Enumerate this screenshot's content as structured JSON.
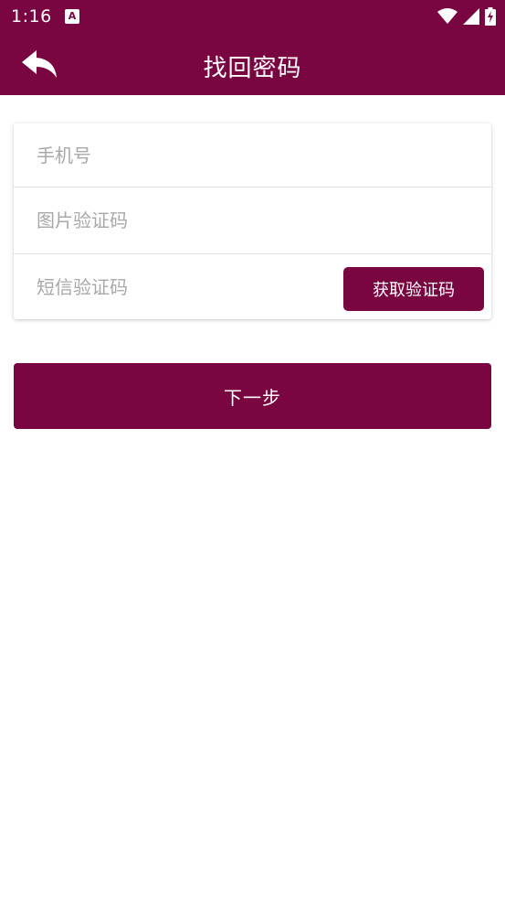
{
  "status_bar": {
    "time": "1:16",
    "notification_icon": "A",
    "icons": [
      "wifi-icon",
      "signal-icon",
      "battery-charging-icon"
    ]
  },
  "app_bar": {
    "title": "找回密码",
    "back_icon": "reply-arrow-icon"
  },
  "form": {
    "phone_placeholder": "手机号",
    "image_code_placeholder": "图片验证码",
    "sms_code_placeholder": "短信验证码",
    "get_code_label": "获取验证码"
  },
  "next_button_label": "下一步",
  "colors": {
    "primary": "#7a0641",
    "placeholder": "#a8a8a8",
    "divider": "#e2e2e2"
  }
}
